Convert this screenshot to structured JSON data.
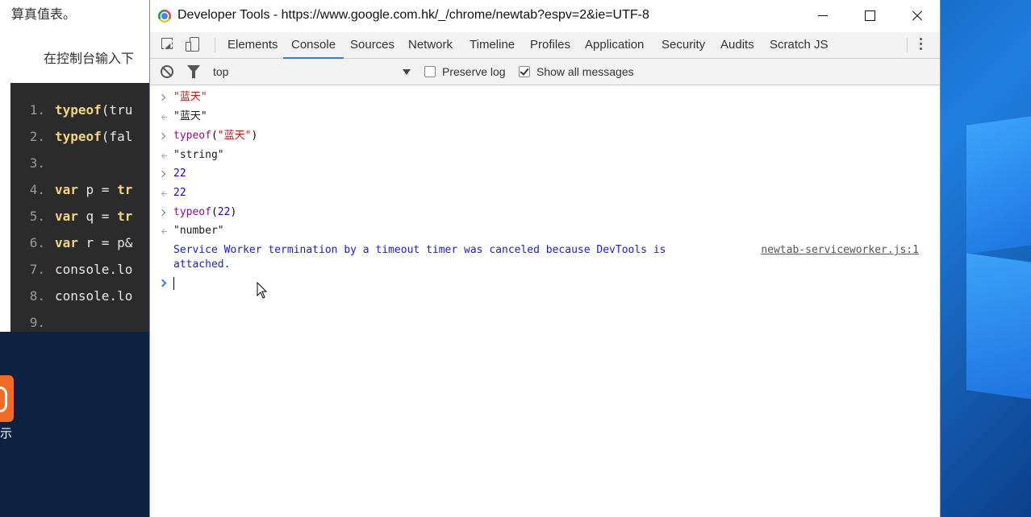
{
  "background_page": {
    "line1": "算真值表。",
    "line2": "在控制台输入下",
    "code_lines": [
      {
        "num": "1.",
        "kw": "typeof",
        "rest": "(tru"
      },
      {
        "num": "2.",
        "kw": "typeof",
        "rest": "(fal"
      },
      {
        "num": "3.",
        "kw": "",
        "rest": ""
      },
      {
        "num": "4.",
        "kw": "var",
        "rest": " p = ",
        "kw2": "tr"
      },
      {
        "num": "5.",
        "kw": "var",
        "rest": " q = ",
        "kw2": "tr"
      },
      {
        "num": "6.",
        "kw": "var",
        "rest": " r = p&"
      },
      {
        "num": "7.",
        "kw": "",
        "rest": "console.lo"
      },
      {
        "num": "8.",
        "kw": "",
        "rest": "console.lo"
      },
      {
        "num": "9.",
        "kw": "",
        "rest": ""
      }
    ],
    "below_text": "示"
  },
  "window": {
    "title": "Developer Tools - https://www.google.com.hk/_/chrome/newtab?espv=2&ie=UTF-8"
  },
  "tabs": [
    "Elements",
    "Console",
    "Sources",
    "Network",
    "Timeline",
    "Profiles",
    "Application",
    "Security",
    "Audits",
    "Scratch JS"
  ],
  "active_tab": "Console",
  "toolbar": {
    "context": "top",
    "preserve_log_label": "Preserve log",
    "preserve_log_checked": false,
    "show_all_label": "Show all messages",
    "show_all_checked": true
  },
  "console": {
    "entries": [
      {
        "dir": "in",
        "text": "\"蓝天\""
      },
      {
        "dir": "out",
        "text": "\"蓝天\""
      },
      {
        "dir": "in",
        "fn": "typeof",
        "open": "(",
        "arg": "\"蓝天\"",
        "close": ")"
      },
      {
        "dir": "out",
        "text": "\"string\""
      },
      {
        "dir": "in",
        "text": "22"
      },
      {
        "dir": "out",
        "text": "22"
      },
      {
        "dir": "in",
        "fn": "typeof",
        "open": "(",
        "arg": "22",
        "close": ")"
      },
      {
        "dir": "out",
        "text": "\"number\""
      }
    ],
    "info_line1": "Service Worker termination by a timeout timer was canceled because DevTools is",
    "info_line2": "attached.",
    "info_source": "newtab-serviceworker.js:1"
  },
  "colors": {
    "accent": "#3b78e7",
    "string": "#c41a16",
    "number": "#1c00cf",
    "keyword_fn": "#881280",
    "info": "#1c1cd0"
  }
}
